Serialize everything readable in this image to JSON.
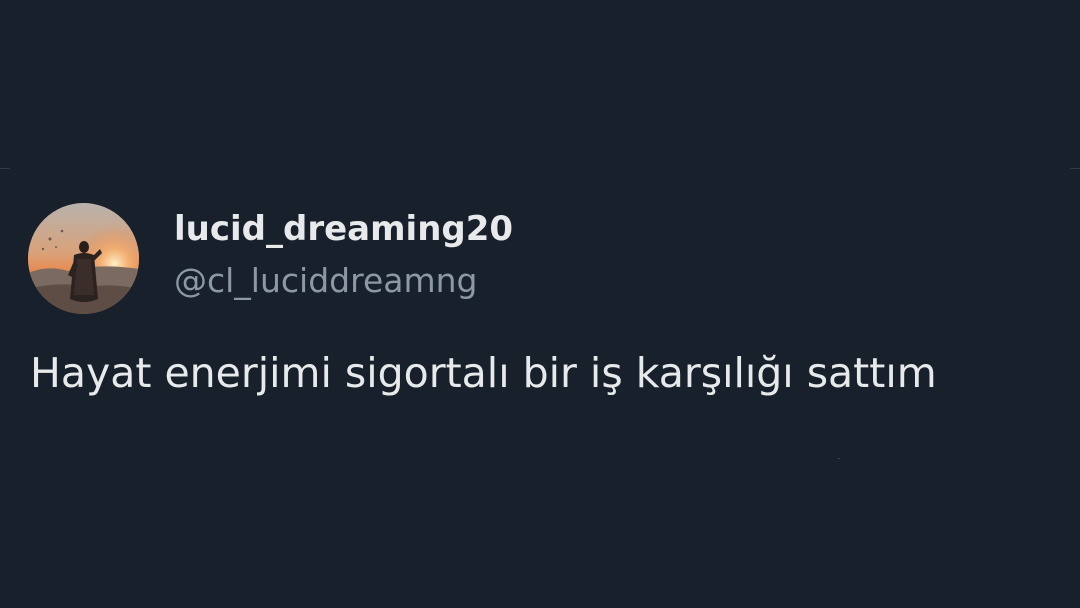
{
  "tweet": {
    "author": {
      "display_name": "lucid_dreaming20",
      "handle": "@cl_luciddreamng",
      "avatar_icon": "profile-photo-avatar"
    },
    "text": "Hayat enerjimi sigortalı bir iş karşılığı sattım"
  },
  "colors": {
    "background": "#17202b",
    "primary_text": "#e7e9ea",
    "secondary_text": "#8b98a5"
  }
}
